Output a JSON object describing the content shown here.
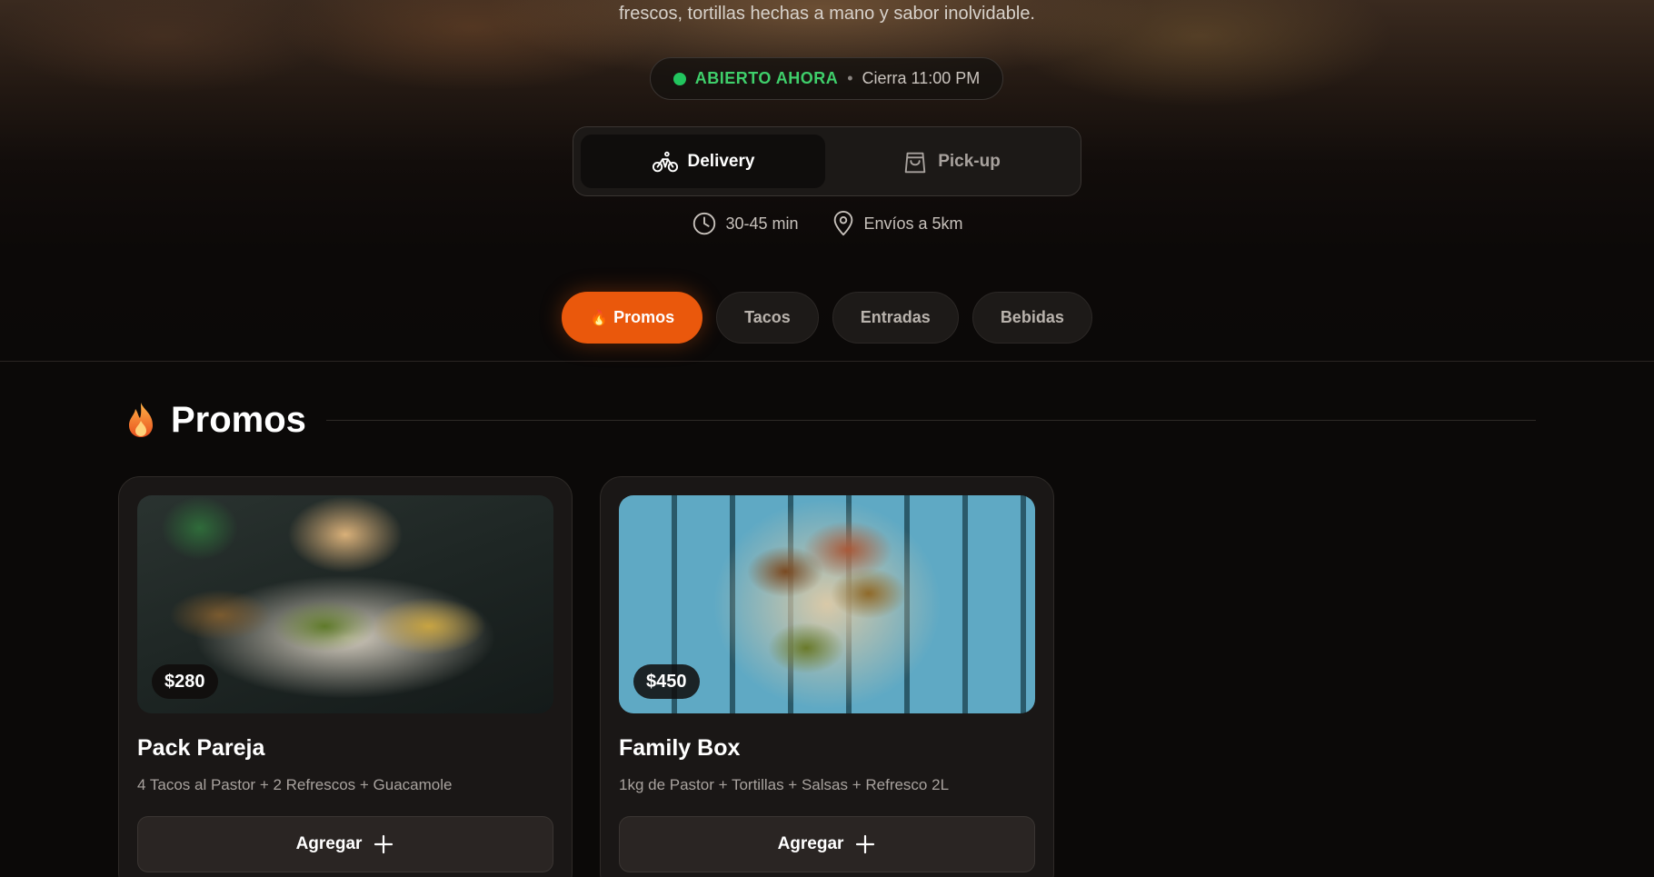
{
  "hero": {
    "tagline": "frescos, tortillas hechas a mano y sabor inolvidable."
  },
  "status": {
    "open_label": "ABIERTO AHORA",
    "separator": "•",
    "close_label": "Cierra 11:00 PM",
    "dot_color": "#22c55e"
  },
  "mode": {
    "delivery_label": "Delivery",
    "pickup_label": "Pick-up",
    "selected": "Delivery"
  },
  "info": {
    "time_label": "30-45 min",
    "range_label": "Envíos a 5km"
  },
  "categories": [
    {
      "label": "Promos",
      "icon": "fire-icon",
      "active": true
    },
    {
      "label": "Tacos",
      "active": false
    },
    {
      "label": "Entradas",
      "active": false
    },
    {
      "label": "Bebidas",
      "active": false
    }
  ],
  "section": {
    "title": "Promos",
    "icon": "fire-icon"
  },
  "products": [
    {
      "price": "$280",
      "name": "Pack Pareja",
      "description": "4 Tacos al Pastor + 2 Refrescos + Guacamole",
      "button": "Agregar"
    },
    {
      "price": "$450",
      "name": "Family Box",
      "description": "1kg de Pastor + Tortillas + Salsas + Refresco 2L",
      "button": "Agregar"
    }
  ],
  "colors": {
    "accent": "#ea580c",
    "background": "#0b0908",
    "card": "#1a1716"
  }
}
